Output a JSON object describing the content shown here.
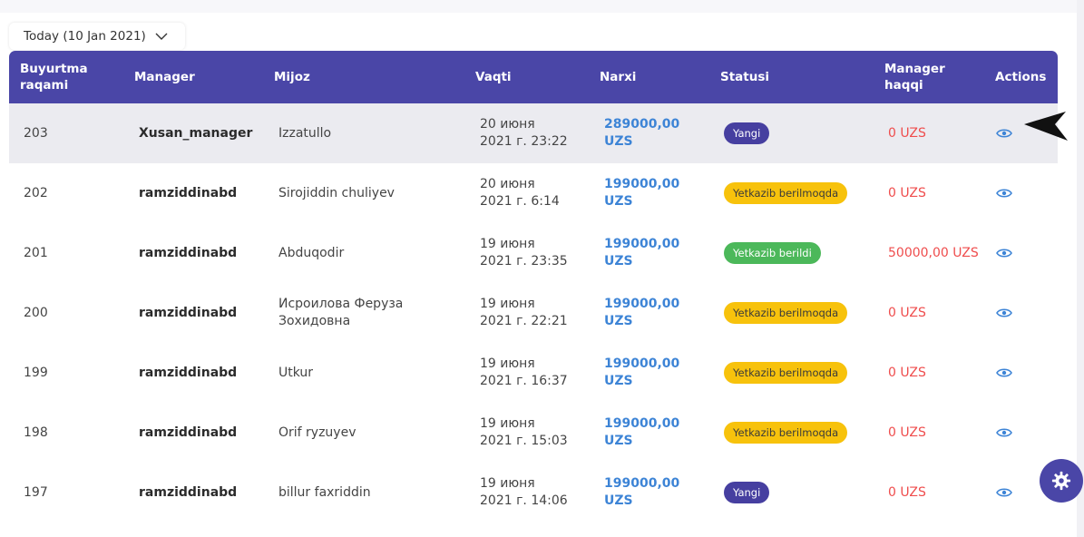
{
  "filter": {
    "date_label": "Today (10 Jan 2021)"
  },
  "columns": {
    "id": [
      "Buyurtma",
      "raqami"
    ],
    "manager": "Manager",
    "client": "Mijoz",
    "time": "Vaqti",
    "price": "Narxi",
    "status": "Statusi",
    "fee": [
      "Manager",
      "haqqi"
    ],
    "actions": "Actions"
  },
  "status_colors": {
    "Yangi": "#463fa0",
    "Yetkazib berilmoqda": "#f7c20c",
    "Yetkazib berildi": "#4cb85a"
  },
  "orders": [
    {
      "id": "203",
      "manager": "Xusan_manager",
      "client": "Izzatullo",
      "date": "20 июня",
      "time": "2021 г. 23:22",
      "price": "289000,00",
      "currency": "UZS",
      "status": "Yangi",
      "fee": "0 UZS"
    },
    {
      "id": "202",
      "manager": "ramziddinabd",
      "client": "Sirojiddin chuliyev",
      "date": "20 июня",
      "time": "2021 г. 6:14",
      "price": "199000,00",
      "currency": "UZS",
      "status": "Yetkazib berilmoqda",
      "fee": "0 UZS"
    },
    {
      "id": "201",
      "manager": "ramziddinabd",
      "client": "Abduqodir",
      "date": "19 июня",
      "time": "2021 г. 23:35",
      "price": "199000,00",
      "currency": "UZS",
      "status": "Yetkazib berildi",
      "fee": "50000,00 UZS"
    },
    {
      "id": "200",
      "manager": "ramziddinabd",
      "client": "Исроилова Феруза Зохидовна",
      "date": "19 июня",
      "time": "2021 г. 22:21",
      "price": "199000,00",
      "currency": "UZS",
      "status": "Yetkazib berilmoqda",
      "fee": "0 UZS"
    },
    {
      "id": "199",
      "manager": "ramziddinabd",
      "client": "Utkur",
      "date": "19 июня",
      "time": "2021 г. 16:37",
      "price": "199000,00",
      "currency": "UZS",
      "status": "Yetkazib berilmoqda",
      "fee": "0 UZS"
    },
    {
      "id": "198",
      "manager": "ramziddinabd",
      "client": "Orif ryzuyev",
      "date": "19 июня",
      "time": "2021 г. 15:03",
      "price": "199000,00",
      "currency": "UZS",
      "status": "Yetkazib berilmoqda",
      "fee": "0 UZS"
    },
    {
      "id": "197",
      "manager": "ramziddinabd",
      "client": "billur faxriddin",
      "date": "19 июня",
      "time": "2021 г. 14:06",
      "price": "199000,00",
      "currency": "UZS",
      "status": "Yangi",
      "fee": "0 UZS"
    }
  ],
  "icons": {
    "view": "eye-icon",
    "settings": "gear-icon",
    "dropdown": "chevron-down-icon",
    "cursor": "arrow-pointer-icon"
  }
}
